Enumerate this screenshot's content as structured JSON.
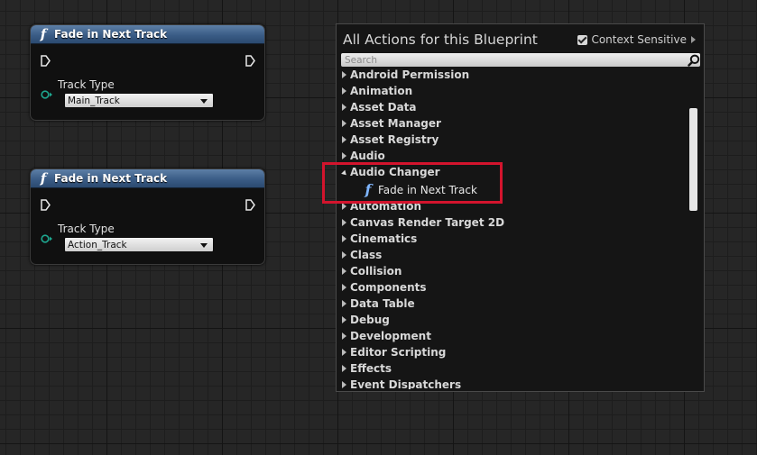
{
  "nodes": [
    {
      "title": "Fade in Next Track",
      "fn_symbol": "f",
      "pin_label": "Track Type",
      "track_value": "Main_Track"
    },
    {
      "title": "Fade in Next Track",
      "fn_symbol": "f",
      "pin_label": "Track Type",
      "track_value": "Action_Track"
    }
  ],
  "action_menu": {
    "title": "All Actions for this Blueprint",
    "context_sensitive_label": "Context Sensitive",
    "context_sensitive_checked": true,
    "search_placeholder": "Search",
    "categories": [
      "Android Permission",
      "Animation",
      "Asset Data",
      "Asset Manager",
      "Asset Registry",
      "Audio",
      "Audio Changer",
      "Automation",
      "Canvas Render Target 2D",
      "Cinematics",
      "Class",
      "Collision",
      "Components",
      "Data Table",
      "Debug",
      "Development",
      "Editor Scripting",
      "Effects",
      "Event Dispatchers"
    ],
    "expanded_category": "Audio Changer",
    "expanded_items": [
      {
        "fn_symbol": "f",
        "label": "Fade in Next Track"
      }
    ]
  },
  "colors": {
    "node_header": "#3a5c86",
    "highlight_box": "#d3142d",
    "function_icon": "#7fb6ff",
    "data_pin": "#1ea890"
  }
}
